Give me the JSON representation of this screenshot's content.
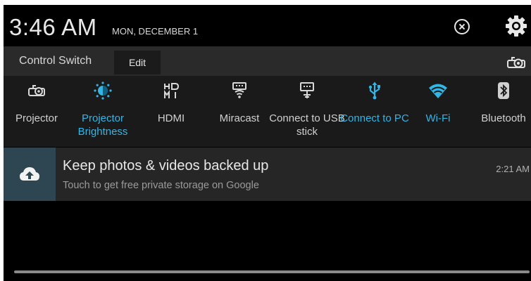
{
  "status": {
    "time": "3:46 AM",
    "date": "MON, DECEMBER 1"
  },
  "header_icons": [
    "clear-notifications-icon",
    "settings-gear-icon"
  ],
  "control": {
    "label": "Control Switch",
    "edit_label": "Edit",
    "toggle_icon": "projector-icon"
  },
  "tiles": [
    {
      "icon": "projector-icon",
      "label": "Projector",
      "active": false
    },
    {
      "icon": "brightness-icon",
      "label": "Projector Brightness",
      "active": true
    },
    {
      "icon": "hdmi-icon",
      "label": "HDMI",
      "active": false
    },
    {
      "icon": "miracast-icon",
      "label": "Miracast",
      "active": false
    },
    {
      "icon": "usb-stick-icon",
      "label": "Connect to USB stick",
      "active": false
    },
    {
      "icon": "usb-icon",
      "label": "Connect to PC",
      "active": true
    },
    {
      "icon": "wifi-icon",
      "label": "Wi-Fi",
      "active": true
    },
    {
      "icon": "bluetooth-icon",
      "label": "Bluetooth",
      "active": false
    }
  ],
  "notification": {
    "icon": "cloud-upload-icon",
    "title": "Keep photos & videos backed up",
    "text": "Touch to get free private storage on Google",
    "time": "2:21 AM"
  },
  "colors": {
    "accent": "#33b5e5",
    "notification_icon_bg": "#2d4652"
  }
}
